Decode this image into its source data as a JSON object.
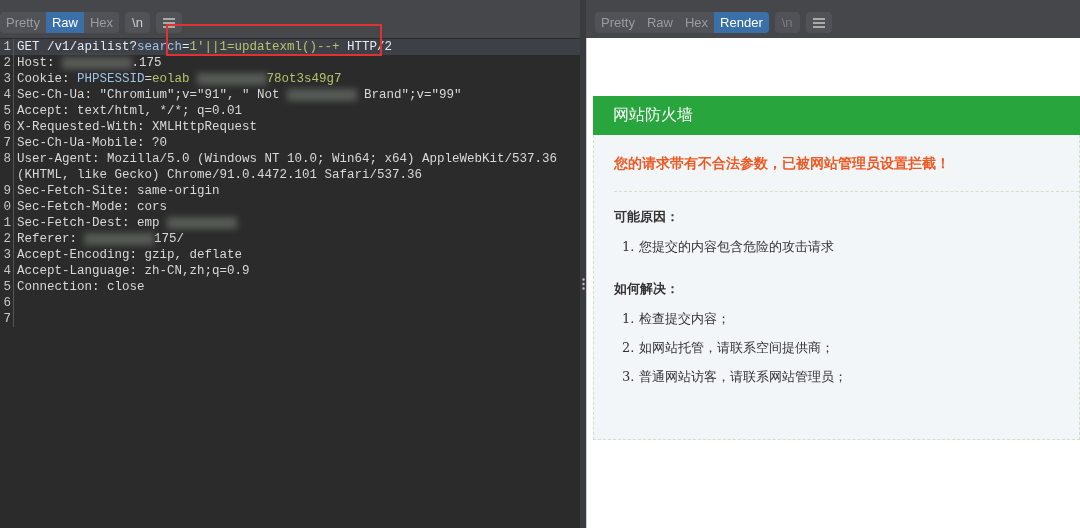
{
  "request_pane": {
    "view_tabs": [
      {
        "label": "Pretty",
        "selected": false
      },
      {
        "label": "Raw",
        "selected": true
      },
      {
        "label": "Hex",
        "selected": false
      }
    ],
    "newline_toggle": {
      "label": "\\n",
      "disabled": false
    },
    "lines": [
      {
        "number": "1",
        "selected": true,
        "parts": [
          {
            "kind": "plain",
            "text": "GET /v1/apilist?"
          },
          {
            "kind": "param",
            "text": "search"
          },
          {
            "kind": "plain",
            "text": "="
          },
          {
            "kind": "arg",
            "text": "1'||1=updatexml()--+"
          },
          {
            "kind": "plain",
            "text": " HTTP/2"
          }
        ]
      },
      {
        "number": "2",
        "selected": false,
        "parts": [
          {
            "kind": "key",
            "text": "Host:"
          },
          {
            "kind": "redacted"
          },
          {
            "kind": "value",
            "text": ".175"
          }
        ]
      },
      {
        "number": "3",
        "selected": false,
        "parts": [
          {
            "kind": "key",
            "text": "Cookie: "
          },
          {
            "kind": "param",
            "text": "PHPSESSID"
          },
          {
            "kind": "plain",
            "text": "="
          },
          {
            "kind": "arg",
            "text": "eolab"
          },
          {
            "kind": "redacted"
          },
          {
            "kind": "arg",
            "text": "78ot3s49g7"
          }
        ]
      },
      {
        "number": "4",
        "selected": false,
        "parts": [
          {
            "kind": "key",
            "text": "Sec-Ch-Ua:"
          },
          {
            "kind": "value",
            "text": " \"Chromium\";v=\"91\", \" Not"
          },
          {
            "kind": "redacted"
          },
          {
            "kind": "value",
            "text": " Brand\";v=\"99\""
          }
        ]
      },
      {
        "number": "5",
        "selected": false,
        "parts": [
          {
            "kind": "key",
            "text": "Accept:"
          },
          {
            "kind": "value",
            "text": " text/html, */*; q=0.01"
          }
        ]
      },
      {
        "number": "6",
        "selected": false,
        "parts": [
          {
            "kind": "key",
            "text": "X-Requested-With:"
          },
          {
            "kind": "value",
            "text": " XMLHttpRequest"
          }
        ]
      },
      {
        "number": "7",
        "selected": false,
        "parts": [
          {
            "kind": "key",
            "text": "Sec-Ch-Ua-Mobile:"
          },
          {
            "kind": "value",
            "text": " ?0"
          }
        ]
      },
      {
        "number": "8",
        "selected": false,
        "parts": [
          {
            "kind": "key",
            "text": "User-Agent:"
          },
          {
            "kind": "value",
            "text": " Mozilla/5.0 (Windows NT 10.0; Win64; x64) AppleWebKit/537.36 (KHTML, like Gecko) Chrome/91.0.4472.101 Safari/537.36"
          }
        ]
      },
      {
        "number": "9",
        "selected": false,
        "parts": [
          {
            "kind": "key",
            "text": "Sec-Fetch-Site:"
          },
          {
            "kind": "value",
            "text": " same-origin"
          }
        ]
      },
      {
        "number": "0",
        "selected": false,
        "parts": [
          {
            "kind": "key",
            "text": "Sec-Fetch-Mode:"
          },
          {
            "kind": "value",
            "text": " cors"
          }
        ]
      },
      {
        "number": "1",
        "selected": false,
        "parts": [
          {
            "kind": "key",
            "text": "Sec-Fetch-Dest:"
          },
          {
            "kind": "value",
            "text": " emp"
          },
          {
            "kind": "redacted"
          }
        ]
      },
      {
        "number": "2",
        "selected": false,
        "parts": [
          {
            "kind": "key",
            "text": "Referer:"
          },
          {
            "kind": "redacted"
          },
          {
            "kind": "value",
            "text": "175/"
          }
        ]
      },
      {
        "number": "3",
        "selected": false,
        "parts": [
          {
            "kind": "key",
            "text": "Accept-Encoding:"
          },
          {
            "kind": "value",
            "text": " gzip, deflate"
          }
        ]
      },
      {
        "number": "4",
        "selected": false,
        "parts": [
          {
            "kind": "key",
            "text": "Accept-Language:"
          },
          {
            "kind": "value",
            "text": " zh-CN,zh;q=0.9"
          }
        ]
      },
      {
        "number": "5",
        "selected": false,
        "parts": [
          {
            "kind": "key",
            "text": "Connection:"
          },
          {
            "kind": "value",
            "text": " close"
          }
        ]
      },
      {
        "number": "6",
        "selected": false
      },
      {
        "number": "7",
        "selected": false
      }
    ]
  },
  "response_pane": {
    "view_tabs": [
      {
        "label": "Pretty",
        "selected": false
      },
      {
        "label": "Raw",
        "selected": false
      },
      {
        "label": "Hex",
        "selected": false
      },
      {
        "label": "Render",
        "selected": true
      }
    ],
    "newline_toggle": {
      "label": "\\n",
      "disabled": true
    },
    "page": {
      "header": "网站防火墙",
      "alert": "您的请求带有不合法参数，已被网站管理员设置拦截！",
      "sections": [
        {
          "heading": "可能原因：",
          "items": [
            "1. 您提交的内容包含危险的攻击请求"
          ]
        },
        {
          "heading": "如何解决：",
          "items": [
            "1. 检查提交内容；",
            "2. 如网站托管，请联系空间提供商；",
            "3. 普通网站访客，请联系网站管理员；"
          ]
        }
      ]
    }
  }
}
